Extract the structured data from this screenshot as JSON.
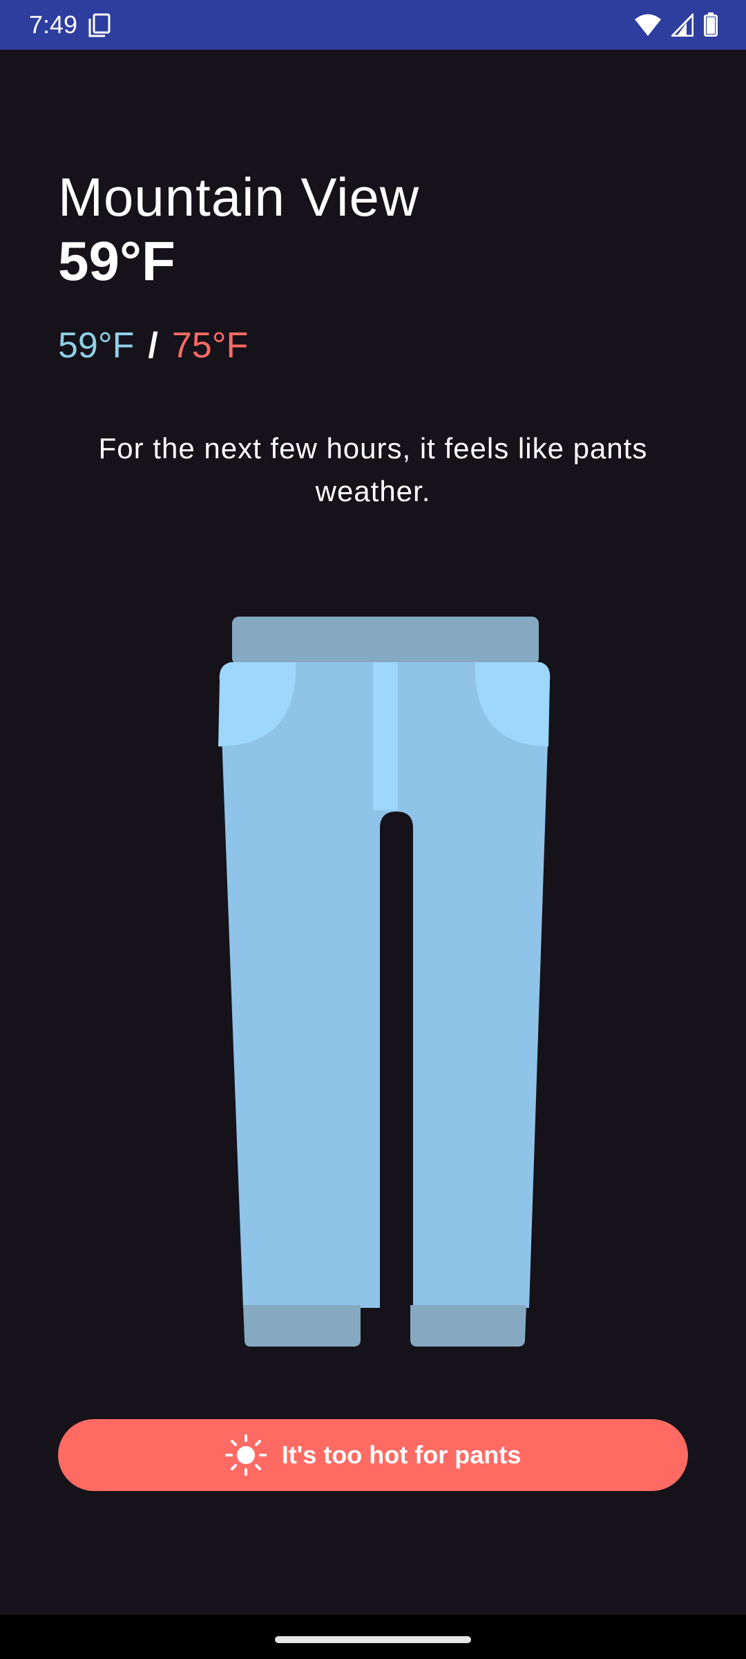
{
  "status_bar": {
    "time": "7:49",
    "icons": [
      "copy-icon",
      "wifi-icon",
      "signal-icon",
      "battery-icon"
    ],
    "background": "#2e3e9e"
  },
  "weather": {
    "city": "Mountain View",
    "current_temp": "59°F",
    "low_temp": "59°F",
    "separator": "/",
    "high_temp": "75°F",
    "message": "For the next few hours, it feels like pants weather.",
    "low_color": "#8ecfe6",
    "high_color": "#ff6b63"
  },
  "illustration": {
    "icon": "pants-icon",
    "colors": {
      "body": "#90c3e8",
      "waistband": "#86a9c2",
      "cuff": "#86a9c2",
      "pocket": "#9dd7fb",
      "fly": "#9dd7fb"
    }
  },
  "action": {
    "label": "It's too hot for pants",
    "icon": "sun-icon",
    "color": "#ff6b63"
  },
  "theme": {
    "background": "#15121a"
  }
}
